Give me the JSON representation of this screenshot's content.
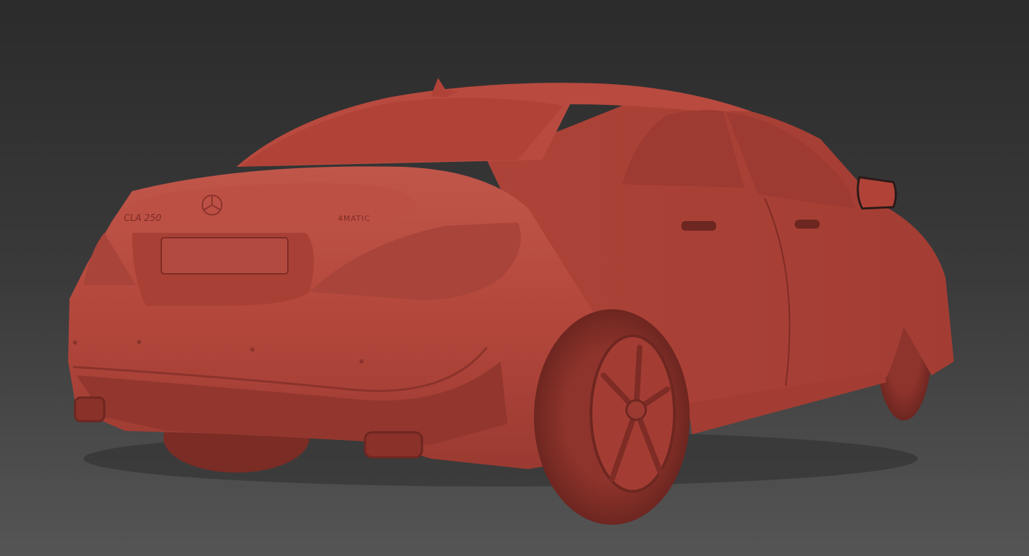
{
  "scene": {
    "badges": {
      "model": "CLA 250",
      "drive": "4MATIC"
    },
    "colors": {
      "body": "#b4473c",
      "shadow": "#7e2c25",
      "background_top": "#2b2b2b",
      "background_bottom": "#555555"
    }
  }
}
